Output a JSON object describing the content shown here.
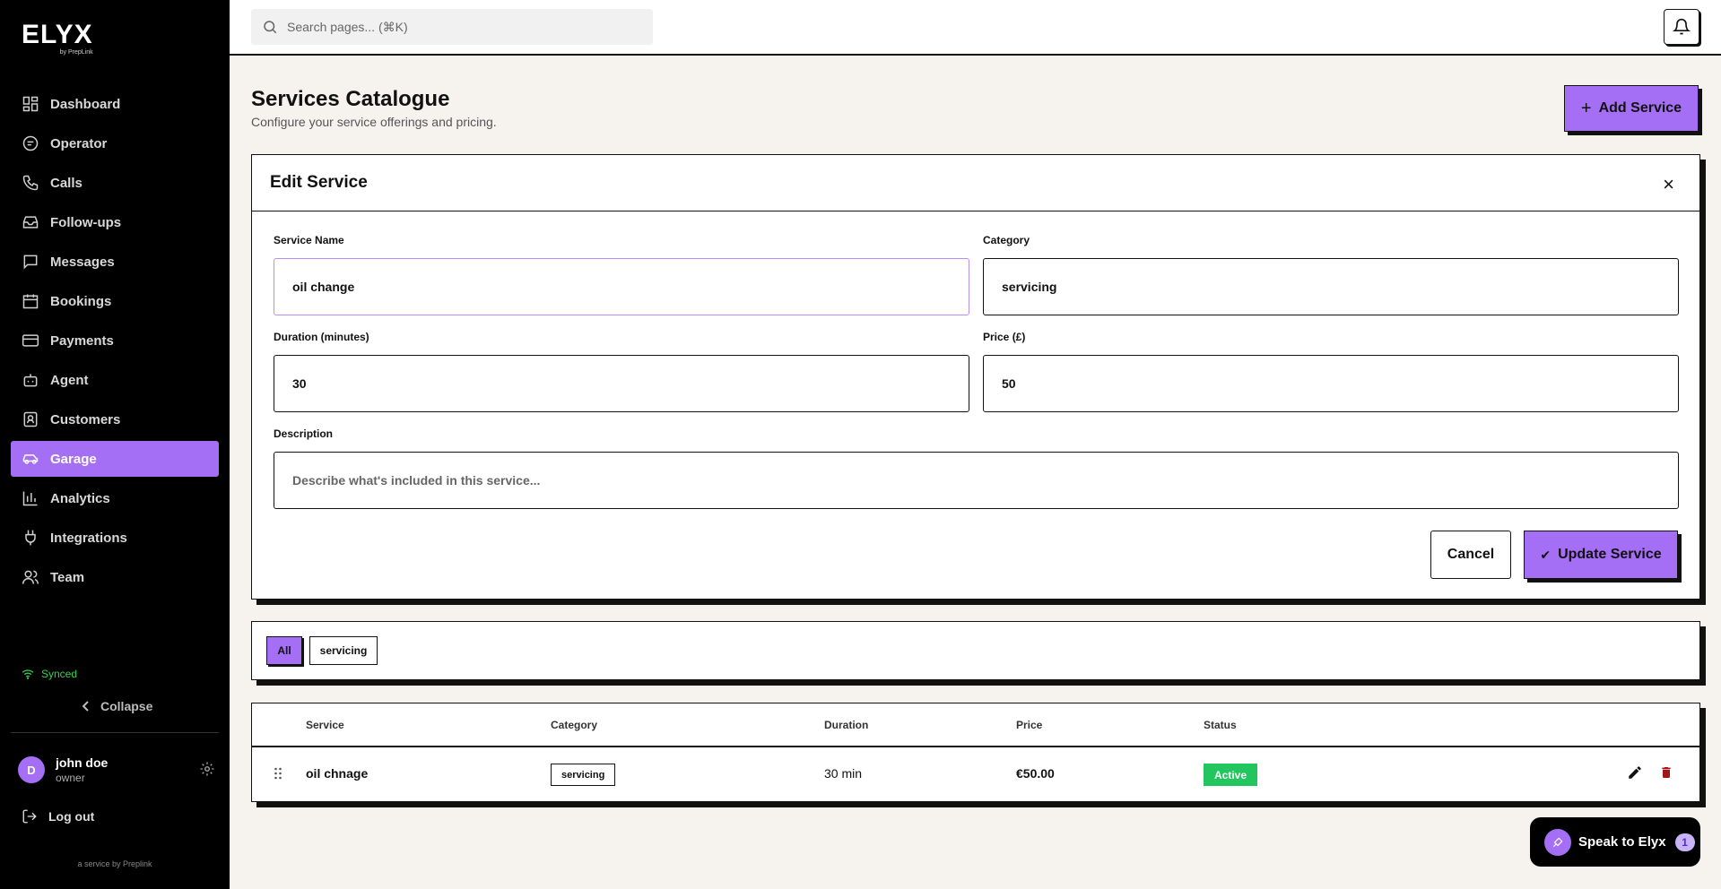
{
  "brand": {
    "name": "ELYX",
    "tagline": "by PrepLink"
  },
  "search": {
    "placeholder": "Search pages... (⌘K)"
  },
  "sidebar": {
    "items": [
      {
        "label": "Dashboard",
        "icon": "dashboard-icon"
      },
      {
        "label": "Operator",
        "icon": "operator-icon"
      },
      {
        "label": "Calls",
        "icon": "phone-icon"
      },
      {
        "label": "Follow-ups",
        "icon": "inbox-icon"
      },
      {
        "label": "Messages",
        "icon": "message-icon"
      },
      {
        "label": "Bookings",
        "icon": "calendar-icon"
      },
      {
        "label": "Payments",
        "icon": "credit-card-icon"
      },
      {
        "label": "Agent",
        "icon": "bot-icon"
      },
      {
        "label": "Customers",
        "icon": "contact-icon"
      },
      {
        "label": "Garage",
        "icon": "car-icon",
        "active": true
      },
      {
        "label": "Analytics",
        "icon": "bar-chart-icon"
      },
      {
        "label": "Integrations",
        "icon": "plug-icon"
      },
      {
        "label": "Team",
        "icon": "users-icon"
      }
    ],
    "sync_status": "Synced",
    "collapse_label": "Collapse",
    "user": {
      "initial": "D",
      "name": "john doe",
      "role": "owner"
    },
    "logout_label": "Log out",
    "footer": "a service by Preplink"
  },
  "page": {
    "title": "Services Catalogue",
    "subtitle": "Configure your service offerings and pricing.",
    "add_button": "Add Service"
  },
  "edit_form": {
    "title": "Edit Service",
    "service_name": {
      "label": "Service Name",
      "value": "oil change"
    },
    "category": {
      "label": "Category",
      "value": "servicing"
    },
    "duration": {
      "label": "Duration (minutes)",
      "value": "30"
    },
    "price": {
      "label": "Price (£)",
      "value": "50"
    },
    "description": {
      "label": "Description",
      "placeholder": "Describe what's included in this service..."
    },
    "cancel_label": "Cancel",
    "update_label": "Update Service"
  },
  "filters": [
    {
      "label": "All",
      "active": true
    },
    {
      "label": "servicing",
      "active": false
    }
  ],
  "table": {
    "headers": [
      "Service",
      "Category",
      "Duration",
      "Price",
      "Status"
    ],
    "rows": [
      {
        "service": "oil chnage",
        "category": "servicing",
        "duration": "30 min",
        "price": "€50.00",
        "status": "Active"
      }
    ]
  },
  "assistant": {
    "label": "Speak to Elyx",
    "count": "1"
  },
  "colors": {
    "accent": "#a46ef5",
    "active_status": "#22c55e",
    "sync": "#34d24e",
    "background": "#f6f2ee"
  }
}
